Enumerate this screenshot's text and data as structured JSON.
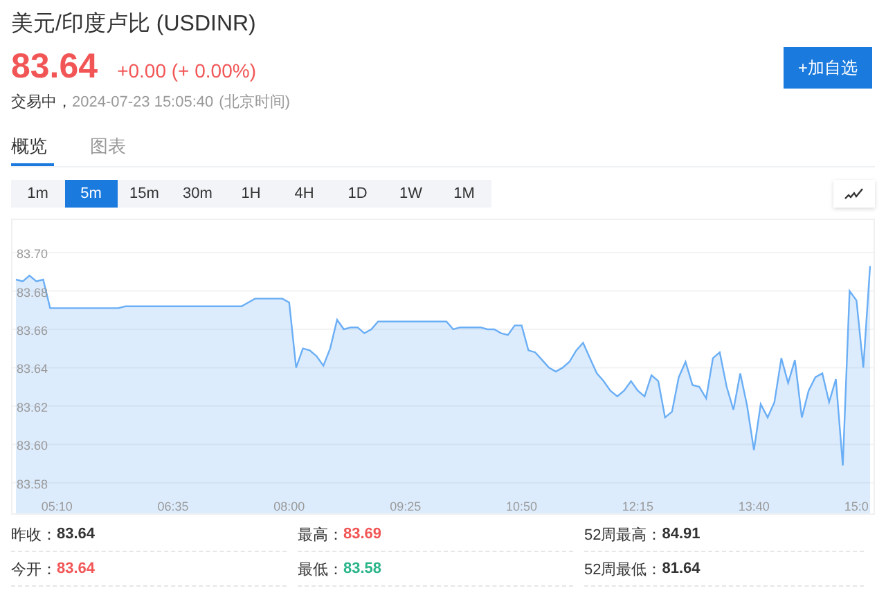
{
  "header": {
    "title": "美元/印度卢比 (USDINR)",
    "price": "83.64",
    "change": "+0.00",
    "change_pct": "(+ 0.00%)",
    "status": "交易中，",
    "timestamp": "2024-07-23 15:05:40",
    "timezone": "(北京时间)",
    "watch_button": "+加自选"
  },
  "tabs": [
    {
      "label": "概览",
      "selected": true
    },
    {
      "label": "图表",
      "selected": false
    }
  ],
  "periods": [
    {
      "label": "1m",
      "selected": false
    },
    {
      "label": "5m",
      "selected": true
    },
    {
      "label": "15m",
      "selected": false
    },
    {
      "label": "30m",
      "selected": false
    },
    {
      "label": "1H",
      "selected": false
    },
    {
      "label": "4H",
      "selected": false
    },
    {
      "label": "1D",
      "selected": false
    },
    {
      "label": "1W",
      "selected": false
    },
    {
      "label": "1M",
      "selected": false
    }
  ],
  "chart": {
    "chart_data": {
      "type": "area",
      "categories": [
        null,
        null,
        null,
        null,
        null,
        null,
        "05:10",
        null,
        null,
        null,
        null,
        null,
        null,
        null,
        null,
        null,
        null,
        null,
        null,
        null,
        null,
        null,
        null,
        "06:35",
        null,
        null,
        null,
        null,
        null,
        null,
        null,
        null,
        null,
        null,
        null,
        null,
        null,
        null,
        null,
        null,
        "08:00",
        null,
        null,
        null,
        null,
        null,
        null,
        null,
        null,
        null,
        null,
        null,
        null,
        null,
        null,
        null,
        null,
        "09:25",
        null,
        null,
        null,
        null,
        null,
        null,
        null,
        null,
        null,
        null,
        null,
        null,
        null,
        null,
        null,
        null,
        "10:50",
        null,
        null,
        null,
        null,
        null,
        null,
        null,
        null,
        null,
        null,
        null,
        null,
        null,
        null,
        null,
        null,
        "12:15",
        null,
        null,
        null,
        null,
        null,
        null,
        null,
        null,
        null,
        null,
        null,
        null,
        null,
        null,
        null,
        null,
        "13:40",
        null,
        null,
        null,
        null,
        null,
        null,
        null,
        null,
        null,
        null,
        null,
        null,
        null,
        null,
        "15:0",
        null,
        null
      ],
      "series": [
        {
          "color": "#6aaef5",
          "values": [
            83.686,
            83.685,
            83.688,
            83.685,
            83.686,
            83.671,
            83.671,
            83.671,
            83.671,
            83.671,
            83.671,
            83.671,
            83.671,
            83.671,
            83.671,
            83.671,
            83.672,
            83.672,
            83.672,
            83.672,
            83.672,
            83.672,
            83.672,
            83.672,
            83.672,
            83.672,
            83.672,
            83.672,
            83.672,
            83.672,
            83.672,
            83.672,
            83.672,
            83.672,
            83.674,
            83.676,
            83.676,
            83.676,
            83.676,
            83.676,
            83.674,
            83.64,
            83.65,
            83.649,
            83.646,
            83.641,
            83.65,
            83.665,
            83.66,
            83.661,
            83.661,
            83.658,
            83.66,
            83.664,
            83.664,
            83.664,
            83.664,
            83.664,
            83.664,
            83.664,
            83.664,
            83.664,
            83.664,
            83.664,
            83.66,
            83.661,
            83.661,
            83.661,
            83.661,
            83.66,
            83.66,
            83.658,
            83.657,
            83.662,
            83.662,
            83.649,
            83.648,
            83.644,
            83.64,
            83.638,
            83.64,
            83.643,
            83.649,
            83.653,
            83.645,
            83.637,
            83.633,
            83.628,
            83.625,
            83.628,
            83.633,
            83.628,
            83.625,
            83.636,
            83.633,
            83.614,
            83.617,
            83.635,
            83.643,
            83.631,
            83.63,
            83.624,
            83.645,
            83.648,
            83.63,
            83.618,
            83.637,
            83.62,
            83.597,
            83.621,
            83.614,
            83.622,
            83.645,
            83.632,
            83.644,
            83.614,
            83.628,
            83.635,
            83.637,
            83.622,
            83.634,
            83.589,
            83.68,
            83.675,
            83.64,
            83.693
          ]
        }
      ],
      "ylim": [
        83.564,
        83.717
      ],
      "grid": true,
      "yticks": [
        {
          "value": 83.7,
          "label": "83.70"
        },
        {
          "value": 83.68,
          "label": "83.68"
        },
        {
          "value": 83.66,
          "label": "83.66"
        },
        {
          "value": 83.64,
          "label": "83.64"
        },
        {
          "value": 83.62,
          "label": "83.62"
        },
        {
          "value": 83.6,
          "label": "83.60"
        },
        {
          "value": 83.58,
          "label": "83.58"
        }
      ]
    }
  },
  "stats": [
    {
      "label": "昨收：",
      "value": "83.64",
      "color": "#333333"
    },
    {
      "label": "最高：",
      "value": "83.69",
      "color": "#f25555"
    },
    {
      "label": "52周最高：",
      "value": "84.91",
      "color": "#333333"
    },
    {
      "label": "今开：",
      "value": "83.64",
      "color": "#f25555"
    },
    {
      "label": "最低：",
      "value": "83.58",
      "color": "#2bb58a"
    },
    {
      "label": "52周最低：",
      "value": "81.64",
      "color": "#333333"
    }
  ]
}
